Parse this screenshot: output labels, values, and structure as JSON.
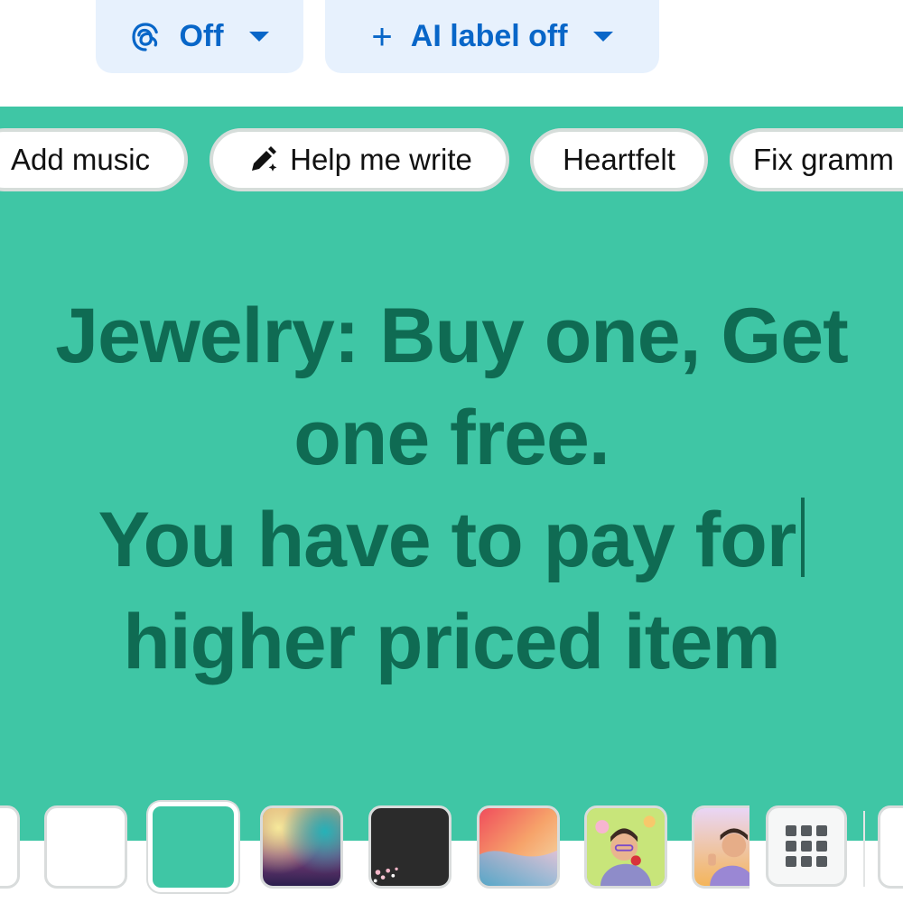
{
  "header": {
    "threads_toggle": {
      "icon": "threads-icon",
      "label": "Off"
    },
    "ai_label": {
      "icon": "plus-icon",
      "label": "AI label off"
    }
  },
  "chips": [
    {
      "label": "Add music"
    },
    {
      "label": "Help me write",
      "icon": "pencil-sparkle-icon"
    },
    {
      "label": "Heartfelt"
    },
    {
      "label": "Fix gramm"
    }
  ],
  "post": {
    "lines": [
      "Jewelry: Buy one, Get",
      "one free.",
      "You have to pay for",
      "higher priced item"
    ],
    "background_color": "#3fc6a5",
    "text_color": "#0f6b53"
  },
  "backgrounds": {
    "options": [
      {
        "name": "white"
      },
      {
        "name": "teal",
        "selected": true,
        "color": "#3fc6a5"
      },
      {
        "name": "rainbow-blur"
      },
      {
        "name": "dark-blossom"
      },
      {
        "name": "gradient-swirl"
      },
      {
        "name": "avatar-flowers"
      },
      {
        "name": "avatar-thumbs-up"
      }
    ],
    "more_icon": "grid-icon"
  },
  "colors": {
    "accent": "#0866c8",
    "pill_bg": "#e7f1fd"
  }
}
